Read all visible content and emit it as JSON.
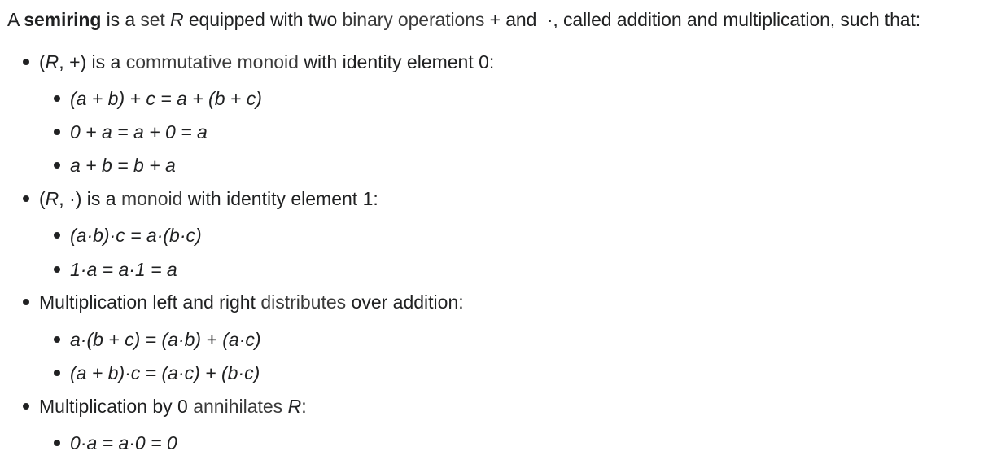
{
  "intro": {
    "t1": "A ",
    "term": "semiring",
    "t2": " is a ",
    "link_set": "set",
    "t3": " ",
    "var_r": "R",
    "t4": " equipped with two ",
    "link_binop": "binary operations",
    "t5": " + and  ·, called addition and multiplication, such that:"
  },
  "items": {
    "add": {
      "lead_open": "(",
      "var_r": "R",
      "lead_mid": ", +) is a ",
      "link": "commutative monoid",
      "tail": " with identity element 0:",
      "eq1": "(a + b) + c = a + (b + c)",
      "eq2": "0 + a = a + 0 = a",
      "eq3": "a + b = b + a"
    },
    "mul": {
      "lead_open": "(",
      "var_r": "R",
      "lead_mid": ", ·) is a ",
      "link": "monoid",
      "tail": " with identity element 1:",
      "eq1": "(a·b)·c = a·(b·c)",
      "eq2": "1·a = a·1 = a"
    },
    "dist": {
      "lead": "Multiplication left and right ",
      "link": "distributes",
      "tail": " over addition:",
      "eq1": "a·(b + c) = (a·b) + (a·c)",
      "eq2": "(a + b)·c = (a·c) + (b·c)"
    },
    "annih": {
      "lead": "Multiplication by 0 ",
      "link": "annihilates",
      "var_r": "R",
      "tail": ":",
      "eq1": "0·a = a·0 = 0"
    }
  }
}
